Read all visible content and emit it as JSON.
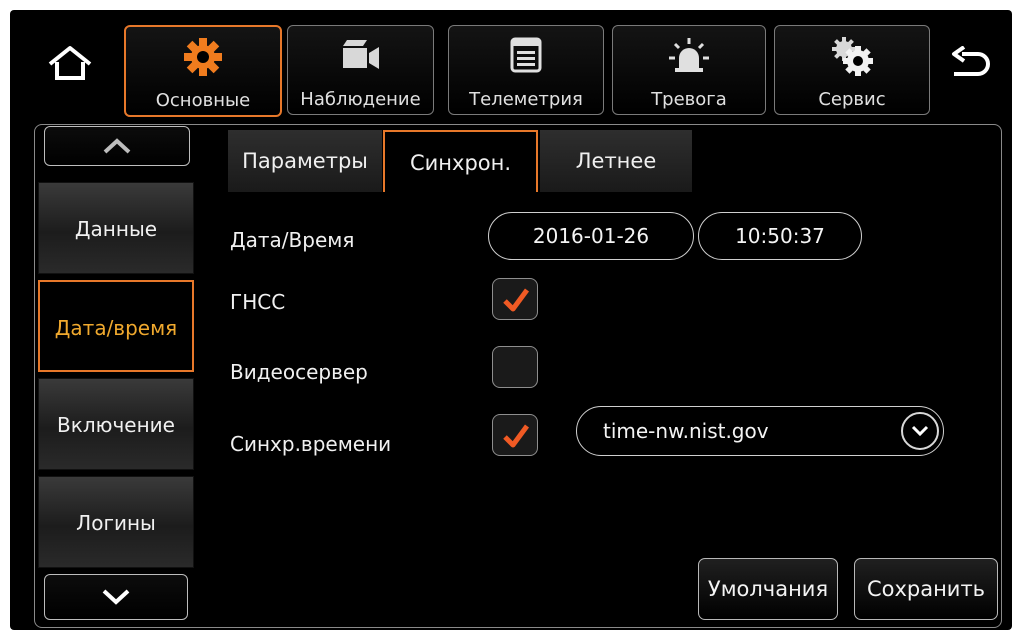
{
  "topbar": {
    "home_icon": "home-icon",
    "back_icon": "back-arrow-icon",
    "items": [
      {
        "label": "Основные",
        "icon": "gear-icon",
        "active": true
      },
      {
        "label": "Наблюдение",
        "icon": "video-camera-icon",
        "active": false
      },
      {
        "label": "Телеметрия",
        "icon": "list-window-icon",
        "active": false
      },
      {
        "label": "Тревога",
        "icon": "alarm-light-icon",
        "active": false
      },
      {
        "label": "Сервис",
        "icon": "gears-icon",
        "active": false
      }
    ]
  },
  "sidebar": {
    "items": [
      {
        "label": "Данные",
        "active": false
      },
      {
        "label": "Дата/время",
        "active": true
      },
      {
        "label": "Включение",
        "active": false
      },
      {
        "label": "Логины",
        "active": false
      }
    ]
  },
  "tabs": [
    {
      "label": "Параметры",
      "active": false
    },
    {
      "label": "Синхрон.",
      "active": true
    },
    {
      "label": "Летнее",
      "active": false
    }
  ],
  "form": {
    "datetime_label": "Дата/Время",
    "date_value": "2016-01-26",
    "time_value": "10:50:37",
    "gnss_label": "ГНСС",
    "gnss_checked": true,
    "videoserver_label": "Видеосервер",
    "videoserver_checked": false,
    "timesync_label": "Синхр.времени",
    "timesync_checked": true,
    "ntp_server": "time-nw.nist.gov"
  },
  "buttons": {
    "defaults": "Умолчания",
    "save": "Сохранить"
  },
  "colors": {
    "accent": "#e7782a",
    "active_text": "#f0a92e",
    "background": "#000000"
  }
}
